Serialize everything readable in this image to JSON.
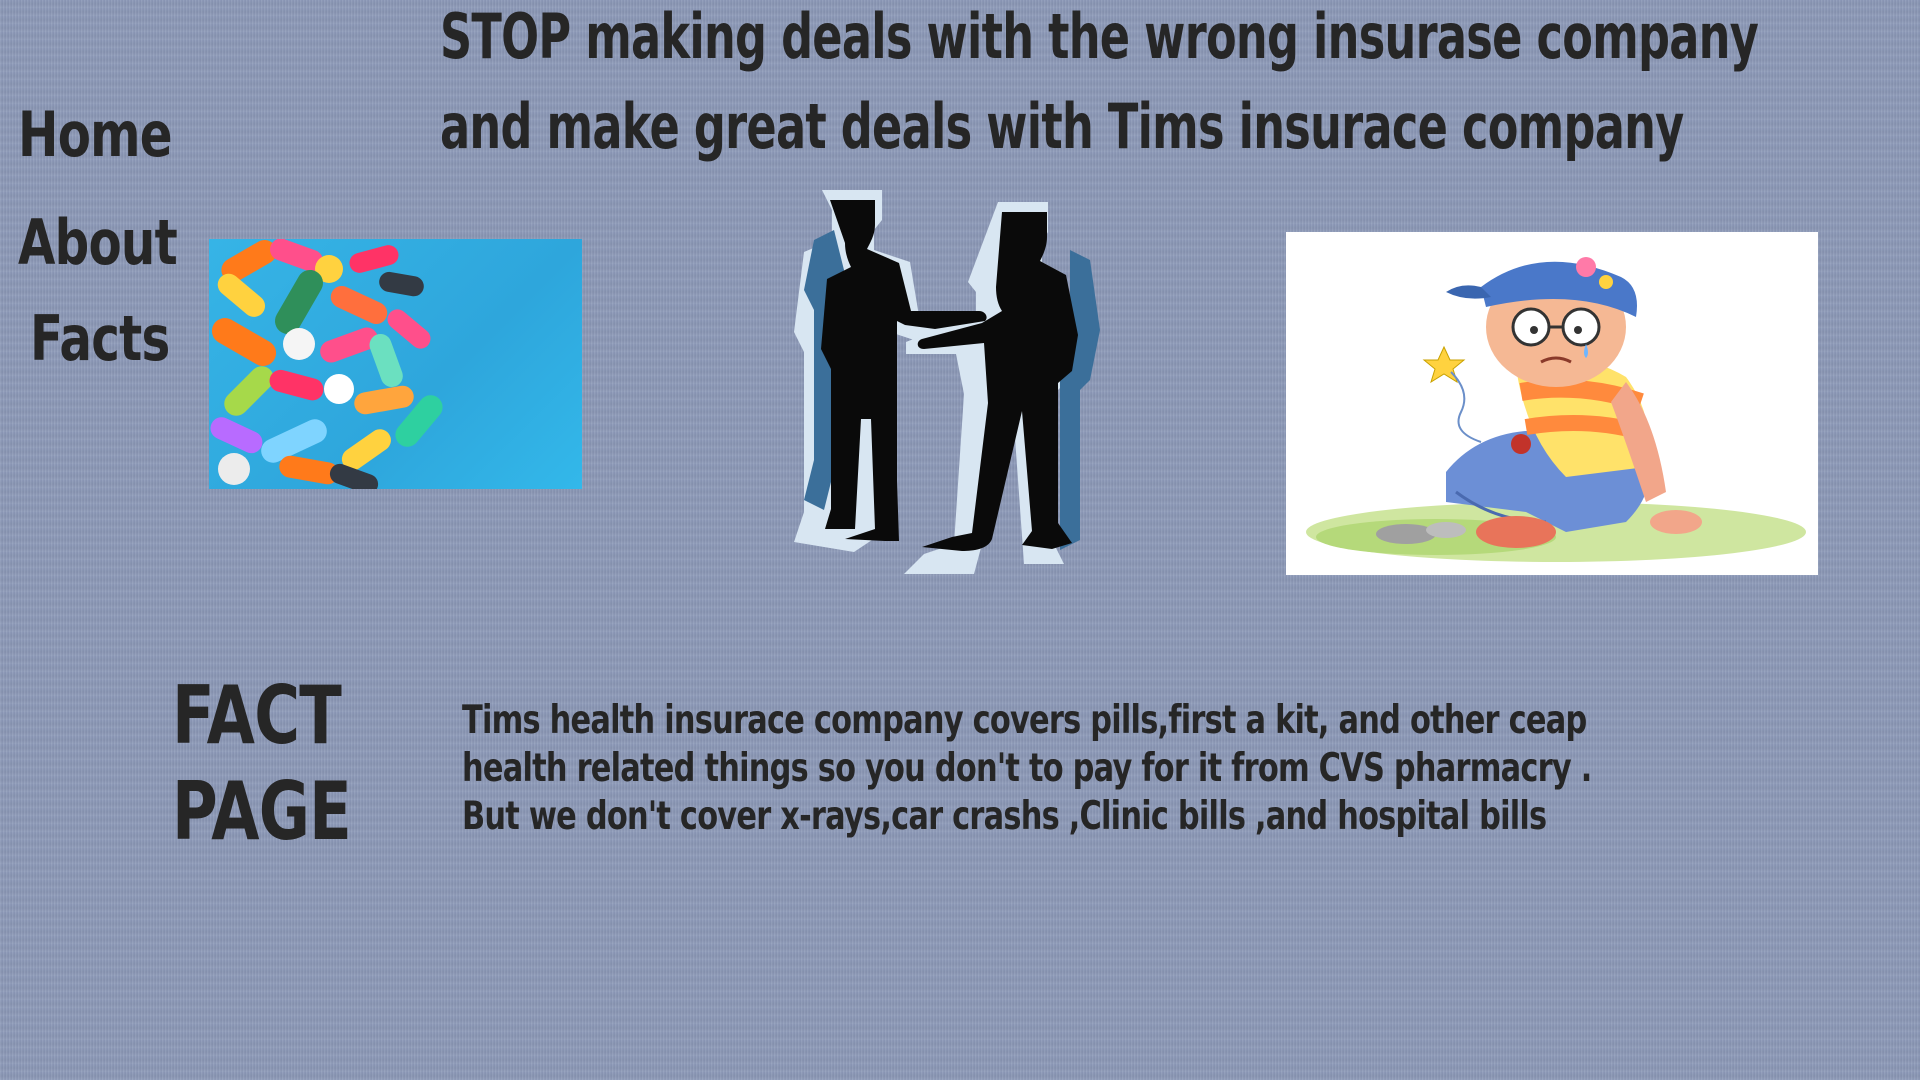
{
  "headline": {
    "line1": "STOP  making deals with the wrong insurase company",
    "line2": "and make great deals with Tims insurace company"
  },
  "nav": {
    "home": "Home",
    "about": "About",
    "facts": "Facts"
  },
  "images": {
    "pills": "pills-photo",
    "handshake": "handshake-silhouette",
    "kid": "injured-kid-cartoon"
  },
  "fact_section": {
    "title_line1": "FACT",
    "title_line2": "PAGE",
    "text_line1": "Tims health insurace company covers pills,first a kit, and other ceap",
    "text_line2": "health related things  so you don't to pay for it  from CVS pharmacry .",
    "text_line3": "But we don't cover x-rays,car crashs ,Clinic bills ,and hospital bills"
  },
  "colors": {
    "background": "#8c99b8",
    "text": "#262626",
    "pills_bg": "#36b4e6"
  }
}
